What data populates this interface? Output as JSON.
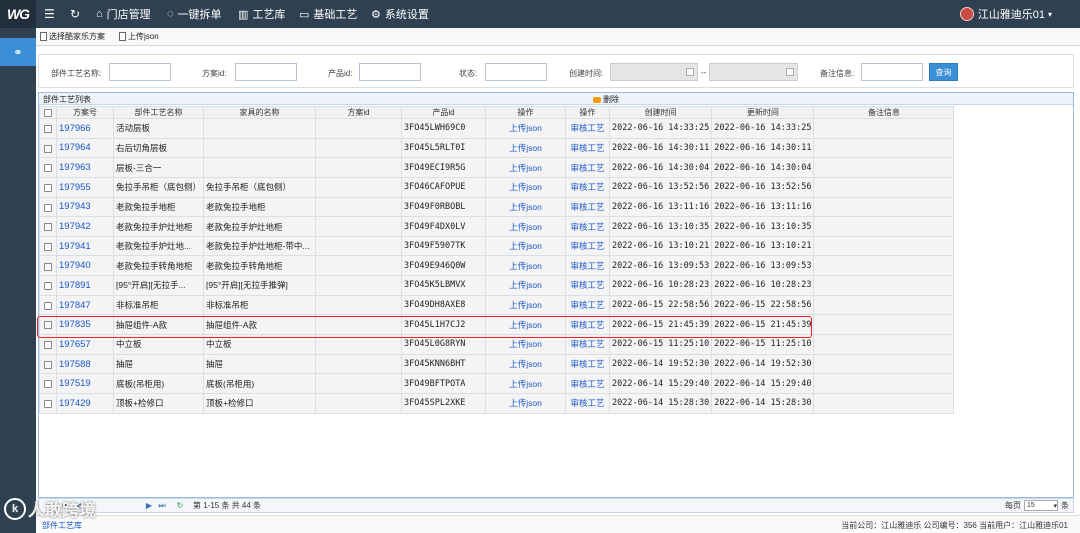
{
  "app": {
    "logo_text": "WG"
  },
  "topnav": {
    "items": [
      {
        "label": "门店管理",
        "icon": "home-icon"
      },
      {
        "label": "一键拆单",
        "icon": "shield-check-icon"
      },
      {
        "label": "工艺库",
        "icon": "library-icon"
      },
      {
        "label": "基础工艺",
        "icon": "folder-icon"
      },
      {
        "label": "系统设置",
        "icon": "gear-icon"
      }
    ],
    "active_index": 2
  },
  "user": {
    "name": "江山雅迪乐01"
  },
  "toolbar": {
    "select_scheme": "选择酷家乐方案",
    "upload_json": "上传json"
  },
  "filter": {
    "part_name_label": "部件工艺名称:",
    "scheme_id_label": "方案id:",
    "product_id_label": "产品id:",
    "status_label": "状态:",
    "created_label": "创建时间:",
    "range_sep": "--",
    "note_label": "备注信息:",
    "search_btn": "查询"
  },
  "panel": {
    "title": "部件工艺列表",
    "delete_label": "删除"
  },
  "table": {
    "headers": [
      "方案号",
      "部件工艺名称",
      "家具的名称",
      "方案id",
      "产品id",
      "操作",
      "操作",
      "创建时间",
      "更新时间",
      "备注信息"
    ],
    "rows": [
      {
        "scheme_no": "197966",
        "part_name": "活动层板",
        "furniture_name": "",
        "scheme_id": "",
        "product_id": "3FO45LWH69C0",
        "op1": "上传json",
        "op2": "审核工艺",
        "created": "2022-06-16 14:33:25",
        "updated": "2022-06-16 14:33:25",
        "note": ""
      },
      {
        "scheme_no": "197964",
        "part_name": "右后切角层板",
        "furniture_name": "",
        "scheme_id": "",
        "product_id": "3FO45L5RLT0I",
        "op1": "上传json",
        "op2": "审核工艺",
        "created": "2022-06-16 14:30:11",
        "updated": "2022-06-16 14:30:11",
        "note": ""
      },
      {
        "scheme_no": "197963",
        "part_name": "层板-三合一",
        "furniture_name": "",
        "scheme_id": "",
        "product_id": "3FO49ECI9R5G",
        "op1": "上传json",
        "op2": "审核工艺",
        "created": "2022-06-16 14:30:04",
        "updated": "2022-06-16 14:30:04",
        "note": ""
      },
      {
        "scheme_no": "197955",
        "part_name": "免拉手吊柜（底包侧）",
        "furniture_name": "免拉手吊柜（底包侧）",
        "scheme_id": "",
        "product_id": "3FO46CAFOPUE",
        "op1": "上传json",
        "op2": "审核工艺",
        "created": "2022-06-16 13:52:56",
        "updated": "2022-06-16 13:52:56",
        "note": ""
      },
      {
        "scheme_no": "197943",
        "part_name": "老款免拉手地柜",
        "furniture_name": "老款免拉手地柜",
        "scheme_id": "",
        "product_id": "3FO49F0RBOBL",
        "op1": "上传json",
        "op2": "审核工艺",
        "created": "2022-06-16 13:11:16",
        "updated": "2022-06-16 13:11:16",
        "note": ""
      },
      {
        "scheme_no": "197942",
        "part_name": "老款免拉手炉灶地柜",
        "furniture_name": "老款免拉手炉灶地柜",
        "scheme_id": "",
        "product_id": "3FO49F4DX0LV",
        "op1": "上传json",
        "op2": "审核工艺",
        "created": "2022-06-16 13:10:35",
        "updated": "2022-06-16 13:10:35",
        "note": ""
      },
      {
        "scheme_no": "197941",
        "part_name": "老款免拉手炉灶地...",
        "furniture_name": "老款免拉手炉灶地柜-带中...",
        "scheme_id": "",
        "product_id": "3FO49F5907TK",
        "op1": "上传json",
        "op2": "审核工艺",
        "created": "2022-06-16 13:10:21",
        "updated": "2022-06-16 13:10:21",
        "note": ""
      },
      {
        "scheme_no": "197940",
        "part_name": "老款免拉手转角地柜",
        "furniture_name": "老款免拉手转角地柜",
        "scheme_id": "",
        "product_id": "3FO49E946Q0W",
        "op1": "上传json",
        "op2": "审核工艺",
        "created": "2022-06-16 13:09:53",
        "updated": "2022-06-16 13:09:53",
        "note": ""
      },
      {
        "scheme_no": "197891",
        "part_name": "[95°开启][无拉手...",
        "furniture_name": "[95°开启][无拉手推弹]",
        "scheme_id": "",
        "product_id": "3FO45K5LBMVX",
        "op1": "上传json",
        "op2": "审核工艺",
        "created": "2022-06-16 10:28:23",
        "updated": "2022-06-16 10:28:23",
        "note": ""
      },
      {
        "scheme_no": "197847",
        "part_name": "非标准吊柜",
        "furniture_name": "非标准吊柜",
        "scheme_id": "",
        "product_id": "3FO49DH8AXE8",
        "op1": "上传json",
        "op2": "审核工艺",
        "created": "2022-06-15 22:58:56",
        "updated": "2022-06-15 22:58:56",
        "note": ""
      },
      {
        "scheme_no": "197835",
        "part_name": "抽屉组件-A款",
        "furniture_name": "抽屉组件-A款",
        "scheme_id": "",
        "product_id": "3FO45L1H7CJ2",
        "op1": "上传json",
        "op2": "审核工艺",
        "created": "2022-06-15 21:45:39",
        "updated": "2022-06-15 21:45:39",
        "note": ""
      },
      {
        "scheme_no": "197657",
        "part_name": "中立板",
        "furniture_name": "中立板",
        "scheme_id": "",
        "product_id": "3FO45L0G8RYN",
        "op1": "上传json",
        "op2": "审核工艺",
        "created": "2022-06-15 11:25:10",
        "updated": "2022-06-15 11:25:10",
        "note": ""
      },
      {
        "scheme_no": "197588",
        "part_name": "抽屉",
        "furniture_name": "抽屉",
        "scheme_id": "",
        "product_id": "3FO45KNN6BHT",
        "op1": "上传json",
        "op2": "审核工艺",
        "created": "2022-06-14 19:52:30",
        "updated": "2022-06-14 19:52:30",
        "note": ""
      },
      {
        "scheme_no": "197519",
        "part_name": "底板(吊柜用)",
        "furniture_name": "底板(吊柜用)",
        "scheme_id": "",
        "product_id": "3FO49BFTPOTA",
        "op1": "上传json",
        "op2": "审核工艺",
        "created": "2022-06-14 15:29:40",
        "updated": "2022-06-14 15:29:40",
        "note": ""
      },
      {
        "scheme_no": "197429",
        "part_name": "顶板+检修口",
        "furniture_name": "顶板+检修口",
        "scheme_id": "",
        "product_id": "3FO45SPL2XKE",
        "op1": "上传json",
        "op2": "审核工艺",
        "created": "2022-06-14 15:28:30",
        "updated": "2022-06-14 15:28:30",
        "note": ""
      }
    ]
  },
  "pager": {
    "range_text": "第 1-15 条  共 44 条",
    "per_page_label": "每页",
    "page_size": "15",
    "unit": "条"
  },
  "status": {
    "tab_label": "部件工艺库",
    "info": "当前公司：江山雅迪乐    公司编号：356    当前用户：江山雅迪乐01"
  },
  "watermark": {
    "text": "人敢跨境"
  },
  "colors": {
    "topbar": "#2f4151",
    "accent": "#3b8fd6",
    "link": "#1a56c8",
    "highlight": "#e22222"
  }
}
